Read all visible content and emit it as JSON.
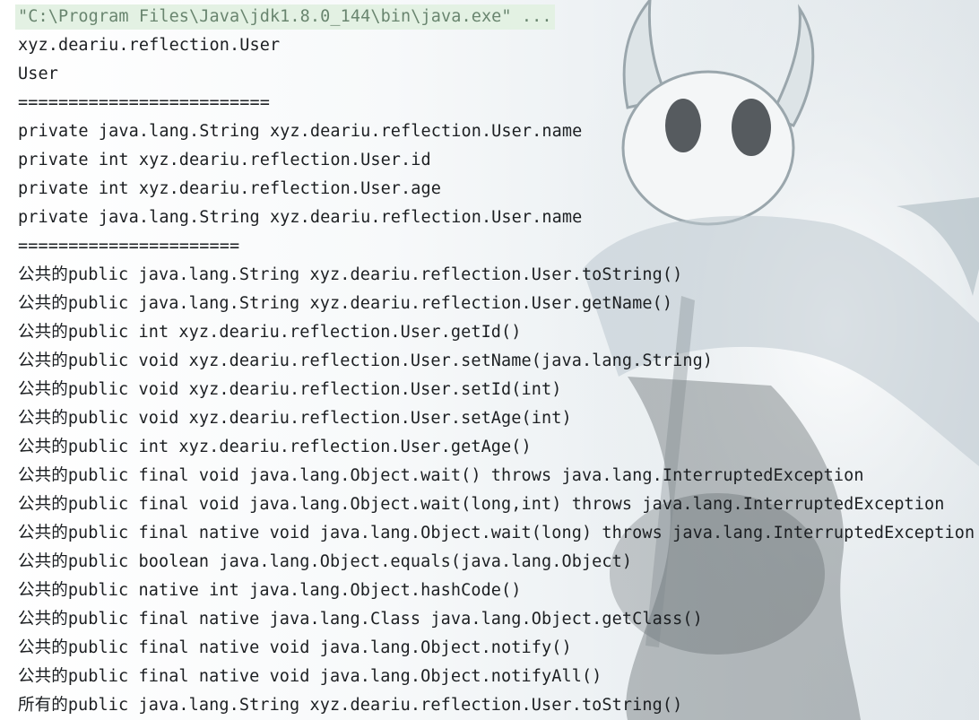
{
  "console": {
    "command_line": "\"C:\\Program Files\\Java\\jdk1.8.0_144\\bin\\java.exe\" ...",
    "output": [
      {
        "prefix": "",
        "text": "xyz.deariu.reflection.User"
      },
      {
        "prefix": "",
        "text": "User"
      },
      {
        "prefix": "",
        "text": "========================="
      },
      {
        "prefix": "",
        "text": "private java.lang.String xyz.deariu.reflection.User.name"
      },
      {
        "prefix": "",
        "text": "private int xyz.deariu.reflection.User.id"
      },
      {
        "prefix": "",
        "text": "private int xyz.deariu.reflection.User.age"
      },
      {
        "prefix": "",
        "text": "private java.lang.String xyz.deariu.reflection.User.name"
      },
      {
        "prefix": "",
        "text": "======================"
      },
      {
        "prefix": "公共的",
        "text": "public java.lang.String xyz.deariu.reflection.User.toString()"
      },
      {
        "prefix": "公共的",
        "text": "public java.lang.String xyz.deariu.reflection.User.getName()"
      },
      {
        "prefix": "公共的",
        "text": "public int xyz.deariu.reflection.User.getId()"
      },
      {
        "prefix": "公共的",
        "text": "public void xyz.deariu.reflection.User.setName(java.lang.String)"
      },
      {
        "prefix": "公共的",
        "text": "public void xyz.deariu.reflection.User.setId(int)"
      },
      {
        "prefix": "公共的",
        "text": "public void xyz.deariu.reflection.User.setAge(int)"
      },
      {
        "prefix": "公共的",
        "text": "public int xyz.deariu.reflection.User.getAge()"
      },
      {
        "prefix": "公共的",
        "text": "public final void java.lang.Object.wait() throws java.lang.InterruptedException"
      },
      {
        "prefix": "公共的",
        "text": "public final void java.lang.Object.wait(long,int) throws java.lang.InterruptedException"
      },
      {
        "prefix": "公共的",
        "text": "public final native void java.lang.Object.wait(long) throws java.lang.InterruptedException"
      },
      {
        "prefix": "公共的",
        "text": "public boolean java.lang.Object.equals(java.lang.Object)"
      },
      {
        "prefix": "公共的",
        "text": "public native int java.lang.Object.hashCode()"
      },
      {
        "prefix": "公共的",
        "text": "public final native java.lang.Class java.lang.Object.getClass()"
      },
      {
        "prefix": "公共的",
        "text": "public final native void java.lang.Object.notify()"
      },
      {
        "prefix": "公共的",
        "text": "public final native void java.lang.Object.notifyAll()"
      },
      {
        "prefix": "所有的",
        "text": "public java.lang.String xyz.deariu.reflection.User.toString()"
      }
    ]
  },
  "colors": {
    "text": "#1c1f22",
    "command_text": "#69856f",
    "command_highlight": "#e1f0e2"
  },
  "background": {
    "image": "hollow-knight-character-art"
  }
}
